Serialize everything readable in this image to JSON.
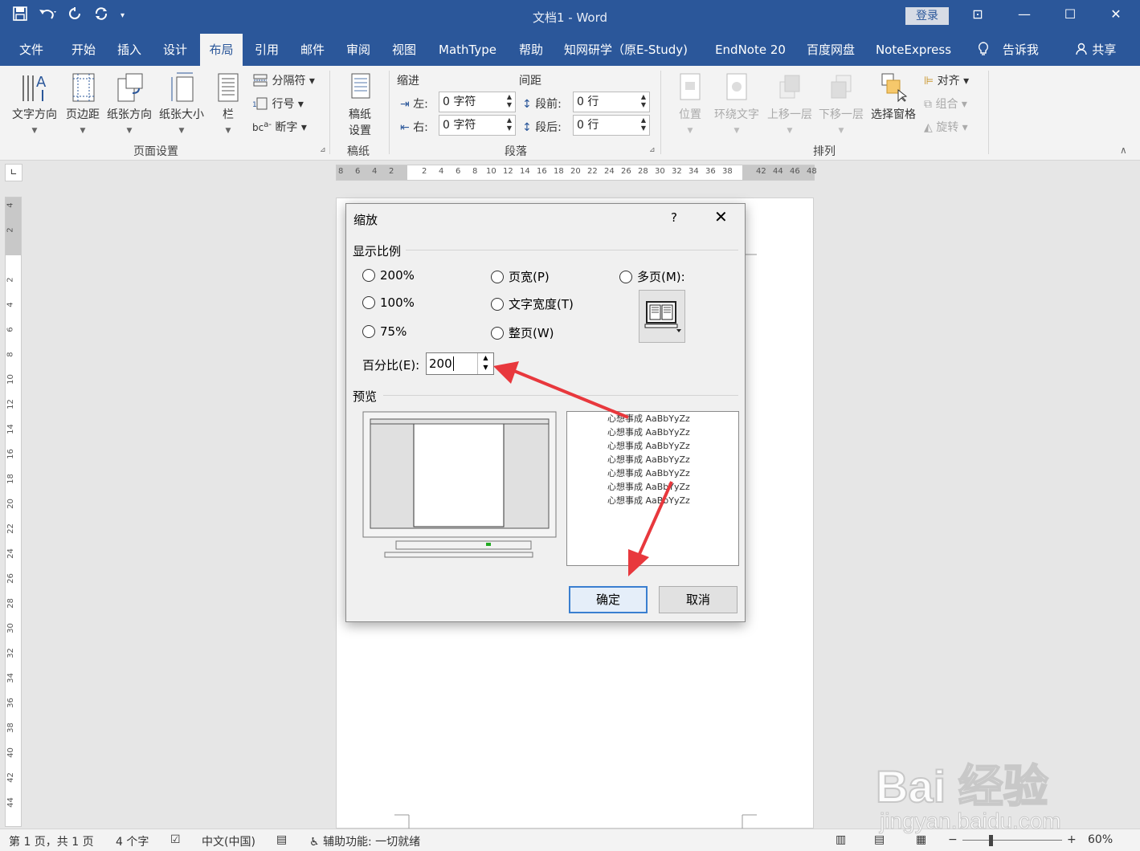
{
  "window": {
    "title": "文档1  -  Word",
    "login_label": "登录",
    "controls": [
      "⊡",
      "—",
      "☐",
      "✕"
    ]
  },
  "tabs": [
    {
      "label": "文件"
    },
    {
      "label": "开始"
    },
    {
      "label": "插入"
    },
    {
      "label": "设计"
    },
    {
      "label": "布局",
      "active": true
    },
    {
      "label": "引用"
    },
    {
      "label": "邮件"
    },
    {
      "label": "审阅"
    },
    {
      "label": "视图"
    },
    {
      "label": "MathType"
    },
    {
      "label": "帮助"
    },
    {
      "label": "知网研学（原E-Study)"
    },
    {
      "label": "EndNote 20"
    },
    {
      "label": "百度网盘"
    },
    {
      "label": "NoteExpress"
    },
    {
      "label": "告诉我"
    },
    {
      "label": "共享"
    }
  ],
  "ribbon": {
    "page_setup": {
      "text_direction": "文字方向",
      "margins": "页边距",
      "orientation": "纸张方向",
      "size": "纸张大小",
      "columns": "栏",
      "breaks": "分隔符",
      "line_numbers": "行号",
      "hyphenation": "断字",
      "group_label": "页面设置"
    },
    "draft": {
      "settings": "稿纸\n设置",
      "settings_line1": "稿纸",
      "settings_line2": "设置",
      "group_label": "稿纸"
    },
    "paragraph": {
      "indent_label": "缩进",
      "spacing_label": "间距",
      "left_label": "左:",
      "right_label": "右:",
      "before_label": "段前:",
      "after_label": "段后:",
      "left_value": "0 字符",
      "right_value": "0 字符",
      "before_value": "0 行",
      "after_value": "0 行",
      "group_label": "段落"
    },
    "arrange": {
      "position": "位置",
      "wrap_text": "环绕文字",
      "bring_forward": "上移一层",
      "send_backward": "下移一层",
      "selection_pane": "选择窗格",
      "align": "对齐",
      "group": "组合",
      "rotate": "旋转",
      "group_label": "排列"
    }
  },
  "ruler": {
    "h_left": [
      "8",
      "6",
      "4",
      "2"
    ],
    "h_right": [
      "2",
      "4",
      "6",
      "8",
      "10",
      "12",
      "14",
      "16",
      "18",
      "20",
      "22",
      "24",
      "26",
      "28",
      "30",
      "32",
      "34",
      "36",
      "38",
      "42",
      "44",
      "46",
      "48"
    ],
    "v_top": [
      "4",
      "2"
    ],
    "v_main": [
      "2",
      "4",
      "6",
      "8",
      "10",
      "12",
      "14",
      "16",
      "18",
      "20",
      "22",
      "24",
      "26",
      "28",
      "30",
      "32",
      "34",
      "36",
      "38",
      "40",
      "42",
      "44"
    ]
  },
  "dialog": {
    "title": "缩放",
    "help": "?",
    "close": "✕",
    "zoom_section": "显示比例",
    "radios": [
      {
        "label": "200%"
      },
      {
        "label": "页宽(P)"
      },
      {
        "label": "多页(M):"
      },
      {
        "label": "100%"
      },
      {
        "label": "文字宽度(T)"
      },
      {
        "label": "75%"
      },
      {
        "label": "整页(W)"
      }
    ],
    "percent_label": "百分比(E):",
    "percent_value": "200",
    "preview_section": "预览",
    "preview_sample": "心想事成  AaBbYyZz",
    "ok": "确定",
    "cancel": "取消"
  },
  "statusbar": {
    "page": "第 1 页，共 1 页",
    "words": "4 个字",
    "language": "中文(中国)",
    "accessibility": "辅助功能: 一切就绪",
    "zoom": "60%",
    "zoom_minus": "−",
    "zoom_plus": "+"
  },
  "watermark": {
    "main": "Bai 经验",
    "sub": "jingyan.baidu.com"
  },
  "colors": {
    "title_bar": "#2b579a",
    "ribbon": "#f3f3f3",
    "annotation_arrow": "#e8383d"
  }
}
